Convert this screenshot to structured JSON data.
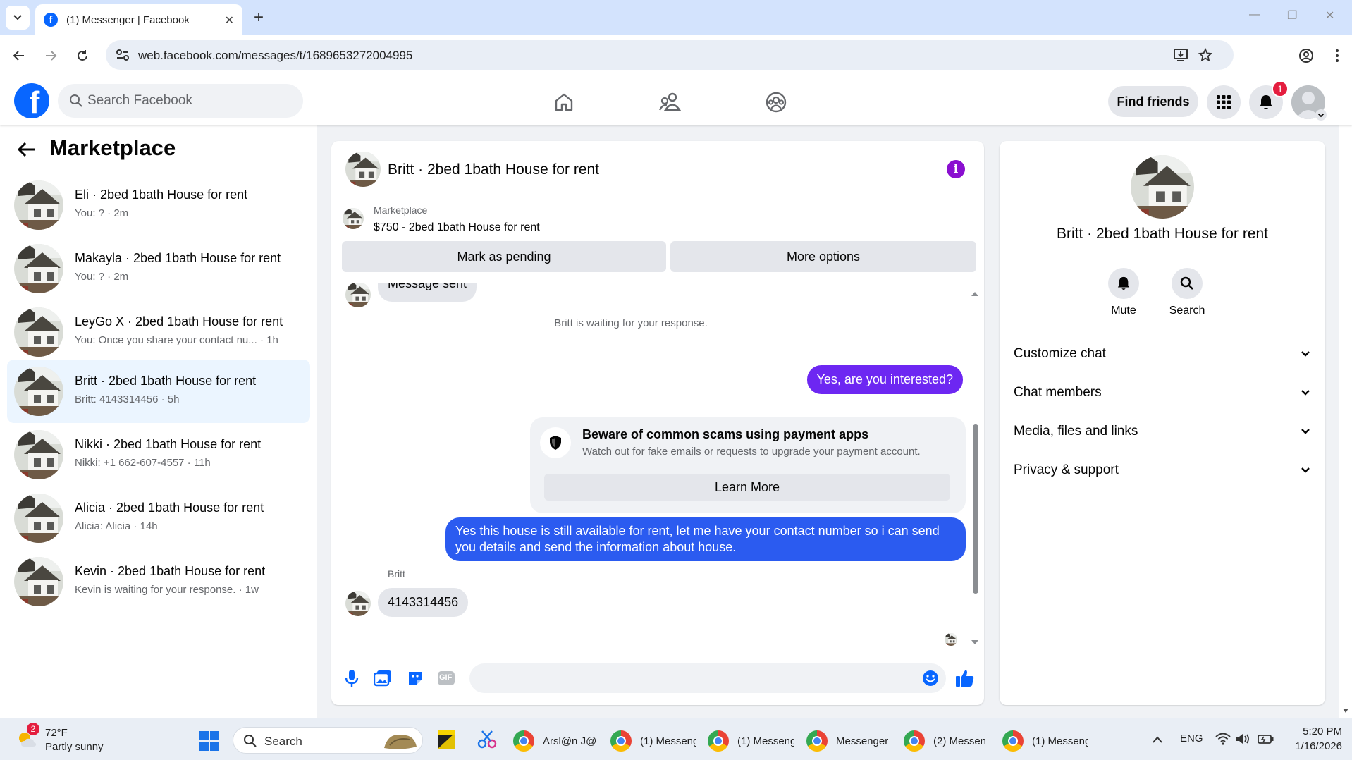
{
  "browser": {
    "tab_title": "(1) Messenger | Facebook",
    "url": "web.facebook.com/messages/t/1689653272004995"
  },
  "fb": {
    "logo_letter": "f",
    "search_placeholder": "Search Facebook",
    "find_friends": "Find friends",
    "notification_count": "1"
  },
  "sidebar": {
    "title": "Marketplace",
    "conversations": [
      {
        "name": "Eli · 2bed 1bath House for rent",
        "snippet": "You: ? · 2m",
        "active": false
      },
      {
        "name": "Makayla · 2bed 1bath House for rent",
        "snippet": "You: ? · 2m",
        "active": false
      },
      {
        "name": "LeyGo X · 2bed 1bath House for rent",
        "snippet": "You: Once you share your contact nu...  · 1h",
        "active": false
      },
      {
        "name": "Britt · 2bed 1bath House for rent",
        "snippet": "Britt: 4143314456 · 5h",
        "active": true
      },
      {
        "name": "Nikki · 2bed 1bath House for rent",
        "snippet": "Nikki: +1 662-607-4557 · 11h",
        "active": false
      },
      {
        "name": "Alicia · 2bed 1bath House for rent",
        "snippet": "Alicia: Alicia · 14h",
        "active": false
      },
      {
        "name": "Kevin · 2bed 1bath House for rent",
        "snippet": "Kevin is waiting for your response. · 1w",
        "active": false
      }
    ]
  },
  "chat": {
    "title": "Britt · 2bed 1bath House for rent",
    "info_glyph": "i",
    "listing_category": "Marketplace",
    "listing_title": "$750 - 2bed 1bath House for rent",
    "mark_pending": "Mark as pending",
    "more_options": "More options",
    "msg_partial": "Message sent",
    "waiting": "Britt is waiting for your response.",
    "out_1": "Yes, are you interested?",
    "scam_title": "Beware of common scams using payment apps",
    "scam_body": "Watch out for fake emails or requests to upgrade your payment account.",
    "learn_more": "Learn More",
    "out_2": "Yes this house is still available for rent, let me have your contact number so i can send you details and send the information about house.",
    "sender": "Britt",
    "in_1": "4143314456",
    "gif_label": "GIF",
    "composer_placeholder": ""
  },
  "info_panel": {
    "name": "Britt · 2bed 1bath House for rent",
    "mute": "Mute",
    "search": "Search",
    "sections": [
      "Customize chat",
      "Chat members",
      "Media, files and links",
      "Privacy & support"
    ]
  },
  "taskbar": {
    "temp": "72°F",
    "condition": "Partly sunny",
    "weather_badge": "2",
    "search": "Search",
    "apps": [
      "Arsl@n J@",
      "(1) Messeng",
      "(1) Messeng",
      "Messenger",
      "(2) Messen",
      "(1) Messeng"
    ],
    "lang": "ENG",
    "time": "5:20 PM",
    "date": "1/16/2026"
  },
  "colors": {
    "fb_blue": "#0866ff",
    "messenger_purple": "#6d27f2",
    "active_convo": "#ebf5ff",
    "badge_red": "#e41e3f"
  }
}
